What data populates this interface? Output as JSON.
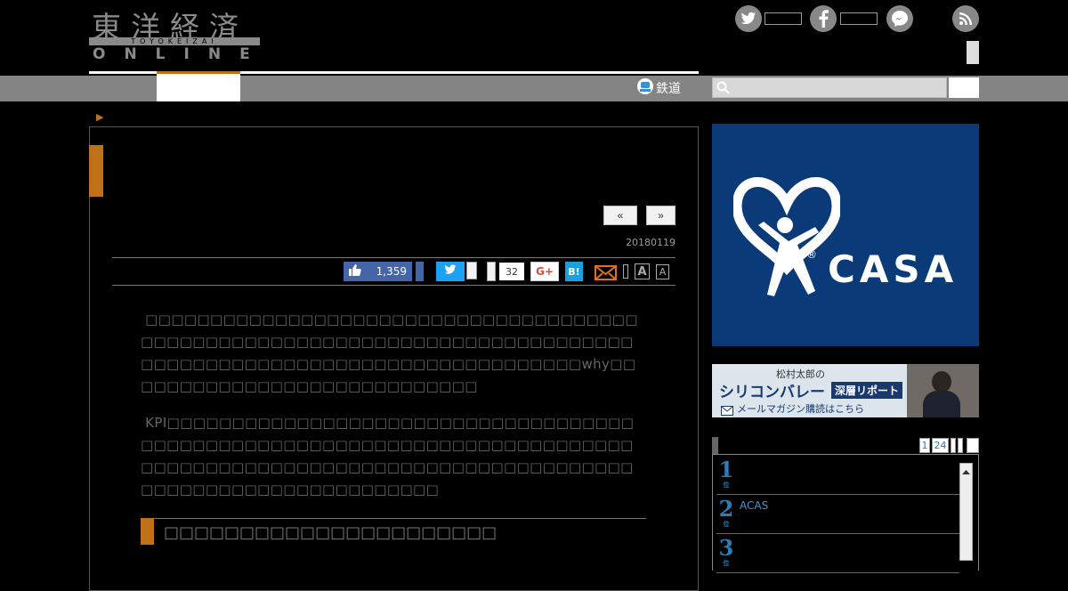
{
  "header": {
    "logo_title": "東洋経済",
    "logo_sub": "TOYOKEIZAI",
    "logo_online": "ONLINE"
  },
  "social_header": {
    "icons": [
      "twitter-icon",
      "facebook-icon",
      "messenger-icon",
      "rss-icon"
    ]
  },
  "nav": {
    "rail_label": "鉄道",
    "search_placeholder": ""
  },
  "article": {
    "pager_prev": "«",
    "pager_next": "»",
    "date": "20180119",
    "share": {
      "fb_count": "1,359",
      "tw_label": "t",
      "count": "32",
      "gplus_label": "G+",
      "hatena_label": "B!",
      "font_large": "A",
      "font_small": "A"
    },
    "para1": " □□□□□□□□□□□□□□□□□□□□□□□□□□□□□□□□□□□□□□□□□□□□□□□□□□□□□□□□□□□□□□□□□□□□□□□□□□□□□□□□□□□□□□□□□□□□□□□□□□□□□□□□□□□□□□why□□□□□□□□□□□□□□□□□□□□□□□□□□□□",
    "para2": " KPI□□□□□□□□□□□□□□□□□□□□□□□□□□□□□□□□□□□□□□□□□□□□□□□□□□□□□□□□□□□□□□□□□□□□□□□□□□□□□□□□□□□□□□□□□□□□□□□□□□□□□□□□□□□□□□□□□□□□□□□□□□□□□□□□□□□□□□□",
    "heading": "□□□□□□□□□□□□□□□□□□□□□□"
  },
  "sidebar": {
    "ad_casa_text": "CASA",
    "ad_casa_mark": "®",
    "banner": {
      "line1": "松村太郎の",
      "line2": "シリコンバレー",
      "line2_tag": "深層リポート",
      "line3": "メールマガジン購読はこちら"
    },
    "ranking": {
      "tabs": [
        "1",
        "24"
      ],
      "items": [
        {
          "rank": "1",
          "suffix": "位",
          "text": ""
        },
        {
          "rank": "2",
          "suffix": "位",
          "text": "ACAS"
        },
        {
          "rank": "3",
          "suffix": "位",
          "text": ""
        }
      ]
    }
  }
}
